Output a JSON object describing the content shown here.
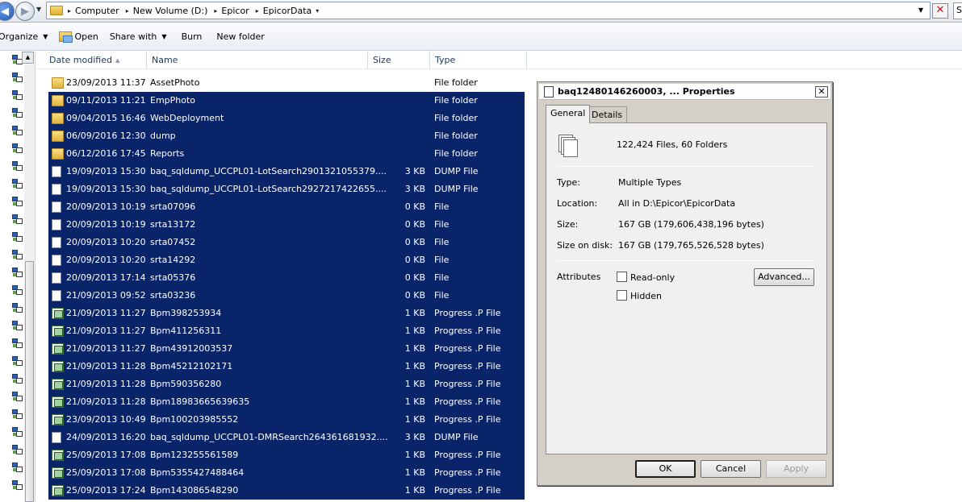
{
  "address": {
    "crumbs": [
      "Computer",
      "New Volume (D:)",
      "Epicor",
      "EpicorData"
    ],
    "search_stub": "S"
  },
  "toolbar": {
    "organize": "Organize",
    "open": "Open",
    "share_with": "Share with",
    "burn": "Burn",
    "new_folder": "New folder"
  },
  "columns": {
    "date_modified": "Date modified",
    "name": "Name",
    "size": "Size",
    "type": "Type"
  },
  "files": [
    {
      "icon": "folder",
      "date": "23/09/2013 11:37",
      "name": "AssetPhoto",
      "size": "",
      "type": "File folder",
      "selected": false
    },
    {
      "icon": "folder",
      "date": "09/11/2013 11:21",
      "name": "EmpPhoto",
      "size": "",
      "type": "File folder",
      "selected": true
    },
    {
      "icon": "folder",
      "date": "09/04/2015 16:46",
      "name": "WebDeployment",
      "size": "",
      "type": "File folder",
      "selected": true
    },
    {
      "icon": "folder",
      "date": "06/09/2016 12:30",
      "name": "dump",
      "size": "",
      "type": "File folder",
      "selected": true
    },
    {
      "icon": "folder",
      "date": "06/12/2016 17:45",
      "name": "Reports",
      "size": "",
      "type": "File folder",
      "selected": true
    },
    {
      "icon": "doc",
      "date": "19/09/2013 15:30",
      "name": "baq_sqldump_UCCPL01-LotSearch2901321055379....",
      "size": "3 KB",
      "type": "DUMP File",
      "selected": true
    },
    {
      "icon": "doc",
      "date": "19/09/2013 15:30",
      "name": "baq_sqldump_UCCPL01-LotSearch2927217422655....",
      "size": "3 KB",
      "type": "DUMP File",
      "selected": true
    },
    {
      "icon": "doc",
      "date": "20/09/2013 10:19",
      "name": "srta07096",
      "size": "0 KB",
      "type": "File",
      "selected": true
    },
    {
      "icon": "doc",
      "date": "20/09/2013 10:19",
      "name": "srta13172",
      "size": "0 KB",
      "type": "File",
      "selected": true
    },
    {
      "icon": "doc",
      "date": "20/09/2013 10:20",
      "name": "srta07452",
      "size": "0 KB",
      "type": "File",
      "selected": true
    },
    {
      "icon": "doc",
      "date": "20/09/2013 10:20",
      "name": "srta14292",
      "size": "0 KB",
      "type": "File",
      "selected": true
    },
    {
      "icon": "doc",
      "date": "20/09/2013 17:14",
      "name": "srta05376",
      "size": "0 KB",
      "type": "File",
      "selected": true
    },
    {
      "icon": "doc",
      "date": "21/09/2013 09:52",
      "name": "srta03236",
      "size": "0 KB",
      "type": "File",
      "selected": true
    },
    {
      "icon": "prog",
      "date": "21/09/2013 11:27",
      "name": "Bpm398253934",
      "size": "1 KB",
      "type": "Progress .P File",
      "selected": true
    },
    {
      "icon": "prog",
      "date": "21/09/2013 11:27",
      "name": "Bpm411256311",
      "size": "1 KB",
      "type": "Progress .P File",
      "selected": true
    },
    {
      "icon": "prog",
      "date": "21/09/2013 11:27",
      "name": "Bpm43912003537",
      "size": "1 KB",
      "type": "Progress .P File",
      "selected": true
    },
    {
      "icon": "prog",
      "date": "21/09/2013 11:28",
      "name": "Bpm45212102171",
      "size": "1 KB",
      "type": "Progress .P File",
      "selected": true
    },
    {
      "icon": "prog",
      "date": "21/09/2013 11:28",
      "name": "Bpm590356280",
      "size": "1 KB",
      "type": "Progress .P File",
      "selected": true
    },
    {
      "icon": "prog",
      "date": "21/09/2013 11:28",
      "name": "Bpm18983665639635",
      "size": "1 KB",
      "type": "Progress .P File",
      "selected": true
    },
    {
      "icon": "prog",
      "date": "23/09/2013 10:49",
      "name": "Bpm100203985552",
      "size": "1 KB",
      "type": "Progress .P File",
      "selected": true
    },
    {
      "icon": "doc",
      "date": "24/09/2013 16:20",
      "name": "baq_sqldump_UCCPL01-DMRSearch264361681932....",
      "size": "3 KB",
      "type": "DUMP File",
      "selected": true
    },
    {
      "icon": "prog",
      "date": "25/09/2013 17:08",
      "name": "Bpm123255561589",
      "size": "1 KB",
      "type": "Progress .P File",
      "selected": true
    },
    {
      "icon": "prog",
      "date": "25/09/2013 17:08",
      "name": "Bpm5355427488464",
      "size": "1 KB",
      "type": "Progress .P File",
      "selected": true
    },
    {
      "icon": "prog",
      "date": "25/09/2013 17:24",
      "name": "Bpm143086548290",
      "size": "1 KB",
      "type": "Progress .P File",
      "selected": true
    }
  ],
  "dialog": {
    "title": "baq12480146260003, ... Properties",
    "close": "✕",
    "tabs": [
      "General",
      "Details"
    ],
    "summary": "122,424 Files, 60 Folders",
    "type_label": "Type:",
    "type_value": "Multiple Types",
    "location_label": "Location:",
    "location_value": "All in D:\\Epicor\\EpicorData",
    "size_label": "Size:",
    "size_value": "167 GB (179,606,438,196 bytes)",
    "size_on_disk_label": "Size on disk:",
    "size_on_disk_value": "167 GB (179,765,526,528 bytes)",
    "attributes_label": "Attributes",
    "readonly_label": "Read-only",
    "hidden_label": "Hidden",
    "advanced_label": "Advanced...",
    "ok_label": "OK",
    "cancel_label": "Cancel",
    "apply_label": "Apply"
  }
}
